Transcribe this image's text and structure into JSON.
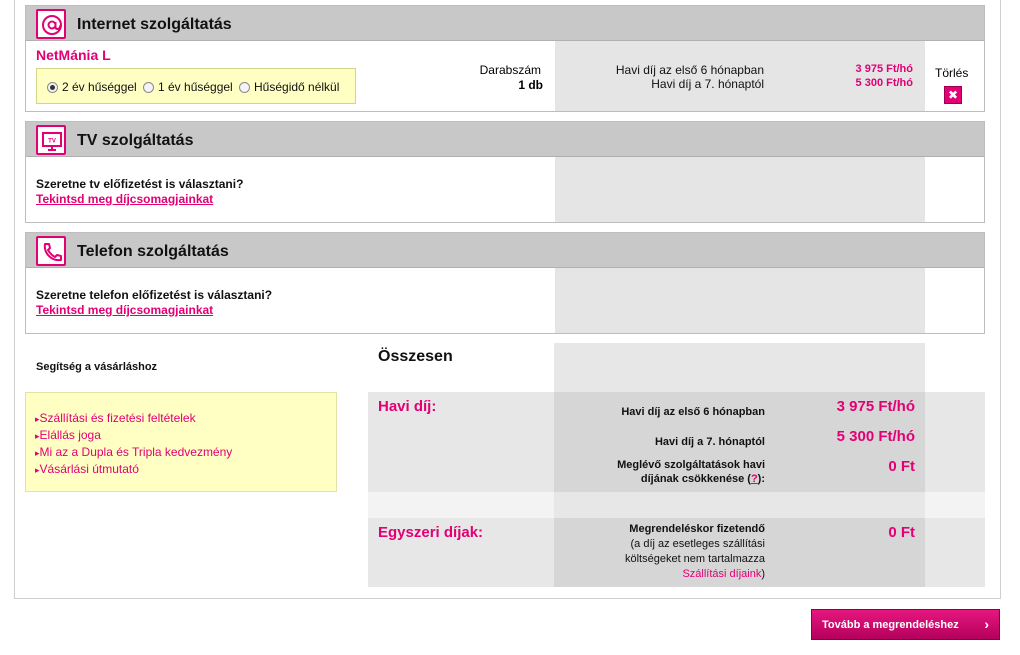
{
  "internet": {
    "title": "Internet szolgáltatás",
    "icon": "at-sign-icon",
    "product_name": "NetMánia L",
    "options": [
      {
        "label": "2 év hűséggel",
        "selected": true
      },
      {
        "label": "1 év hűséggel",
        "selected": false
      },
      {
        "label": "Hűségidő nélkül",
        "selected": false
      }
    ],
    "qty_label": "Darabszám",
    "qty_value": "1 db",
    "fee_first_label": "Havi díj az első 6 hónapban",
    "fee_first_value": "3 975 Ft/hó",
    "fee_after_label": "Havi díj a 7. hónaptól",
    "fee_after_value": "5 300 Ft/hó",
    "delete_label": "Törlés"
  },
  "tv": {
    "title": "TV szolgáltatás",
    "icon": "tv-icon",
    "question": "Szeretne tv előfizetést is választani?",
    "link": "Tekintsd meg díjcsomagjainkat"
  },
  "phone": {
    "title": "Telefon szolgáltatás",
    "icon": "phone-icon",
    "question": "Szeretne telefon előfizetést is választani?",
    "link": "Tekintsd meg díjcsomagjainkat"
  },
  "help": {
    "title": "Segítség a vásárláshoz",
    "links": [
      "Szállítási és fizetési feltételek",
      "Elállás joga",
      "Mi az a Dupla és Tripla kedvezmény",
      "Vásárlási útmutató"
    ]
  },
  "summary": {
    "title": "Összesen",
    "monthly_head": "Havi díj:",
    "monthly_first_label": "Havi díj az első 6 hónapban",
    "monthly_first_value": "3 975 Ft/hó",
    "monthly_after_label": "Havi díj a 7. hónaptól",
    "monthly_after_value": "5 300 Ft/hó",
    "reduction_label_1": "Meglévő szolgáltatások havi",
    "reduction_label_2": "díjának csökkenése (",
    "reduction_q": "?",
    "reduction_label_3": "):",
    "reduction_value": "0 Ft",
    "onetime_head": "Egyszeri díjak:",
    "onetime_label": "Megrendeléskor fizetendő",
    "onetime_note_1": "(a díj az esetleges szállítási",
    "onetime_note_2": "költségeket nem tartalmazza",
    "onetime_note_link": "Szállítási díjaink",
    "onetime_note_end": ")",
    "onetime_value": "0 Ft"
  },
  "next_button": "Tovább a megrendeléshez",
  "colors": {
    "accent": "#e20074",
    "header_grey": "#c8c8c8",
    "highlight_yellow": "#ffffc4"
  }
}
